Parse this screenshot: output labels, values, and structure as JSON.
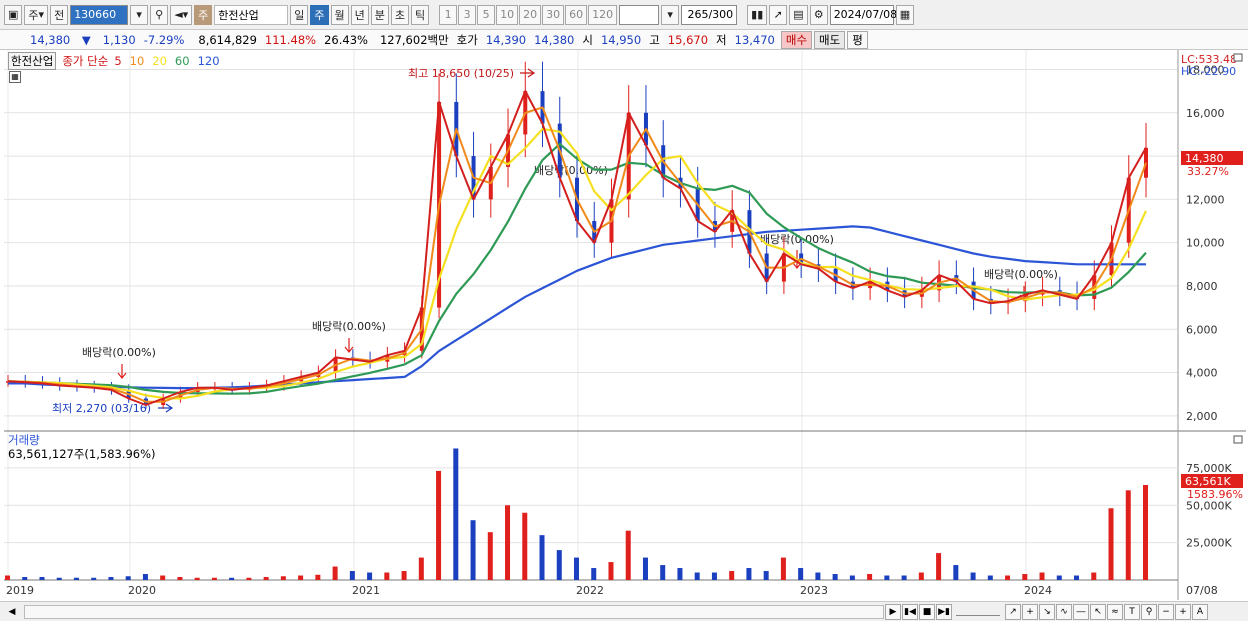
{
  "toolbar": {
    "market": "주",
    "prev": "전",
    "code": "130660",
    "name_badge": "주",
    "stock_name": "한전산업",
    "periods": [
      "일",
      "주",
      "월",
      "년",
      "분",
      "초",
      "틱"
    ],
    "active_period": "주",
    "intervals": [
      "1",
      "3",
      "5",
      "10",
      "20",
      "30",
      "60",
      "120"
    ],
    "count": "265",
    "count_total": "/300",
    "date": "2024/07/08"
  },
  "quote": {
    "price": "14,380",
    "change_arrow": "▼",
    "change": "1,130",
    "change_pct": "-7.29%",
    "volume": "8,614,829",
    "vol_ratio": "111.48%",
    "turnover": "26.43%",
    "amount": "127,602백만",
    "bid_label": "호가",
    "bid1": "14,390",
    "bid2": "14,380",
    "open_label": "시",
    "open": "14,950",
    "high_label": "고",
    "high": "15,670",
    "low_label": "저",
    "low": "13,470",
    "buy": "매수",
    "sell": "매도",
    "eval": "평"
  },
  "legend": {
    "name": "한전산업",
    "ma_label": "종가 단순",
    "ma_periods": [
      "5",
      "10",
      "20",
      "60",
      "120"
    ],
    "ma_colors": [
      "#d41f1f",
      "#f08a1a",
      "#f5e020",
      "#2e9a55",
      "#2b55d6"
    ]
  },
  "right_labels": {
    "lc": "LC:533.48",
    "hc": "HC:-22.90",
    "price": "14,380",
    "pct": "33.27%"
  },
  "annotations": {
    "high": "최고 18,650 (10/25)",
    "low": "최저 2,270 (03/16)",
    "dividend": "배당락(0.00%)"
  },
  "volume": {
    "title": "거래량",
    "value": "63,561,127주(1,583.96%)",
    "right_value": "63,561K",
    "right_pct": "1583.96%",
    "ticks": [
      "75,000K",
      "50,000K",
      "25,000K"
    ]
  },
  "x_ticks": [
    "2019",
    "2020",
    "2021",
    "2022",
    "2023",
    "2024"
  ],
  "x_last": "07/08",
  "chart_data": {
    "type": "candlestick-line",
    "y_ticks": [
      2000,
      4000,
      6000,
      8000,
      10000,
      12000,
      14000,
      16000,
      18000
    ],
    "ylim": [
      1300,
      18900
    ],
    "close": [
      3600,
      3550,
      3500,
      3400,
      3350,
      3300,
      3200,
      2800,
      2500,
      2800,
      3100,
      3300,
      3300,
      3200,
      3300,
      3400,
      3600,
      3800,
      4000,
      4700,
      4600,
      4500,
      4800,
      5000,
      7000,
      16500,
      14000,
      12000,
      13500,
      15000,
      17000,
      15500,
      13000,
      11000,
      10000,
      12000,
      16000,
      14500,
      13000,
      12500,
      11000,
      10500,
      11500,
      9500,
      8200,
      9500,
      9000,
      8800,
      8200,
      7900,
      8200,
      7800,
      7500,
      7800,
      8500,
      8200,
      7400,
      7200,
      7300,
      7600,
      7800,
      7600,
      7400,
      8500,
      10000,
      13000,
      14380
    ],
    "ma120": [
      3500,
      3500,
      3450,
      3420,
      3400,
      3380,
      3350,
      3320,
      3300,
      3290,
      3280,
      3280,
      3300,
      3320,
      3350,
      3400,
      3450,
      3500,
      3550,
      3600,
      3650,
      3700,
      3750,
      3800,
      4300,
      5000,
      5500,
      6000,
      6500,
      7000,
      7500,
      7900,
      8300,
      8700,
      9000,
      9300,
      9500,
      9700,
      9900,
      10000,
      10100,
      10200,
      10300,
      10400,
      10500,
      10550,
      10600,
      10650,
      10700,
      10750,
      10700,
      10500,
      10300,
      10100,
      9900,
      9700,
      9500,
      9350,
      9250,
      9150,
      9100,
      9050,
      9000,
      9000,
      9000,
      9000,
      9000
    ],
    "volume": [
      3000,
      2000,
      2000,
      1500,
      1500,
      1500,
      2000,
      2500,
      4000,
      3000,
      2000,
      1500,
      1500,
      1500,
      1500,
      2000,
      2500,
      3000,
      3500,
      9000,
      6000,
      5000,
      5000,
      6000,
      15000,
      73000,
      88000,
      40000,
      32000,
      50000,
      45000,
      30000,
      20000,
      15000,
      8000,
      12000,
      33000,
      15000,
      10000,
      8000,
      5000,
      5000,
      6000,
      8000,
      6000,
      15000,
      8000,
      5000,
      4000,
      3000,
      4000,
      3000,
      3000,
      5000,
      18000,
      10000,
      5000,
      3000,
      3000,
      4000,
      5000,
      3000,
      3000,
      5000,
      48000,
      60000,
      63561
    ]
  }
}
